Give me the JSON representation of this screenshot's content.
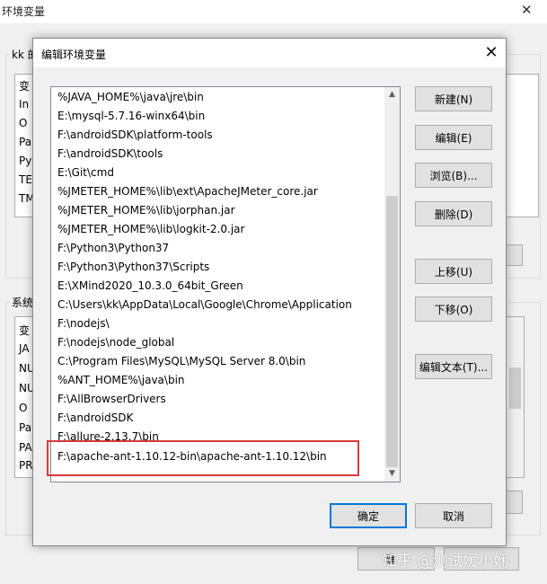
{
  "background": {
    "title": "环境变量",
    "close_glyph": "✕",
    "user_group_label": "kk 的",
    "user_list_header": "变",
    "user_list_items": [
      "In",
      "O",
      "Pa",
      "Py",
      "TE",
      "TM"
    ],
    "system_group_label": "系统",
    "system_list_header": "变",
    "system_list_items": [
      "JA",
      "NU",
      "NU",
      "O",
      "Pa",
      "PA",
      "PR"
    ],
    "ok_label_partial": "确"
  },
  "dialog": {
    "title": "编辑环境变量",
    "close_glyph": "✕",
    "path_items": [
      "%JAVA_HOME%\\java\\jre\\bin",
      "E:\\mysql-5.7.16-winx64\\bin",
      "F:\\androidSDK\\platform-tools",
      "F:\\androidSDK\\tools",
      "E:\\Git\\cmd",
      "%JMETER_HOME%\\lib\\ext\\ApacheJMeter_core.jar",
      "%JMETER_HOME%\\lib\\jorphan.jar",
      "%JMETER_HOME%\\lib\\logkit-2.0.jar",
      "F:\\Python3\\Python37",
      "F:\\Python3\\Python37\\Scripts",
      "E:\\XMind2020_10.3.0_64bit_Green",
      "C:\\Users\\kk\\AppData\\Local\\Google\\Chrome\\Application",
      "F:\\nodejs\\",
      "F:\\nodejs\\node_global",
      "C:\\Program Files\\MySQL\\MySQL Server 8.0\\bin",
      "%ANT_HOME%\\java\\bin",
      "F:\\AllBrowserDrivers",
      "F:\\androidSDK",
      "F:\\allure-2.13.7\\bin",
      "F:\\apache-ant-1.10.12-bin\\apache-ant-1.10.12\\bin"
    ],
    "buttons": {
      "new": "新建(N)",
      "edit": "编辑(E)",
      "browse": "浏览(B)...",
      "delete": "删除(D)",
      "move_up": "上移(U)",
      "move_down": "下移(O)",
      "edit_text": "编辑文本(T)...",
      "ok": "确定",
      "cancel": "取消"
    },
    "scroll_up_glyph": "▲",
    "scroll_down_glyph": "▼"
  },
  "watermark": "知乎 @测试媛小娴",
  "colors": {
    "highlight_border": "#d8393c",
    "primary_button_border": "#0078d7"
  }
}
